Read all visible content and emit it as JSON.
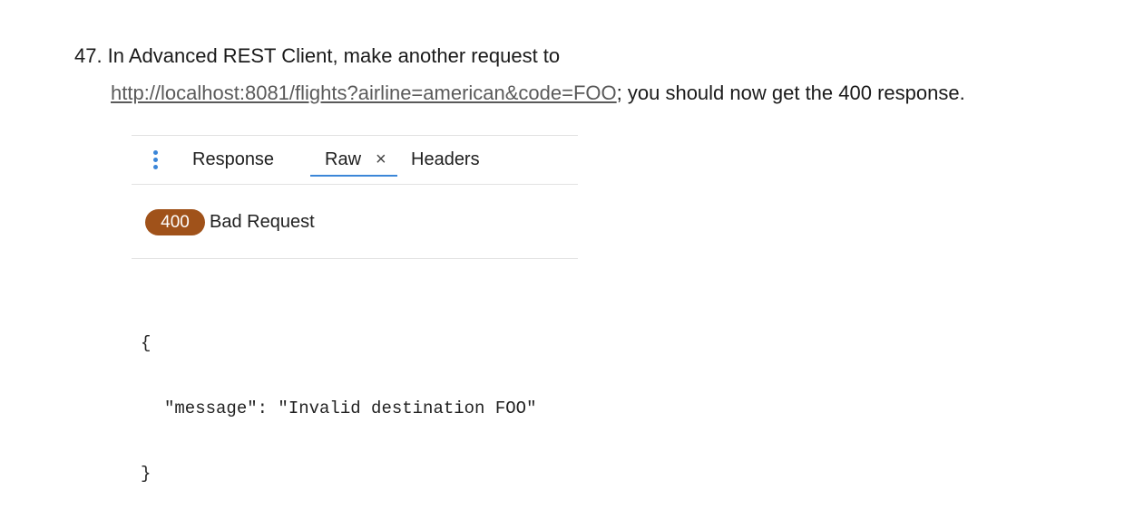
{
  "instruction": {
    "number": "47.",
    "text": "In Advanced REST Client, make another request to",
    "url": "http://localhost:8081/flights?airline=american&code=FOO",
    "suffix": "; you should now get the 400 response."
  },
  "response_panel": {
    "menu_icon": "vertical-dots-icon",
    "tabs": {
      "response": "Response",
      "raw": "Raw",
      "close": "×",
      "headers": "Headers"
    },
    "active_tab": "Raw",
    "status": {
      "code": "400",
      "text": "Bad Request",
      "color": "#a0521a"
    },
    "body": {
      "open_brace": "{",
      "line": "\"message\": \"Invalid destination FOO\"",
      "close_brace": "}"
    },
    "accent_color": "#3b86d8"
  }
}
